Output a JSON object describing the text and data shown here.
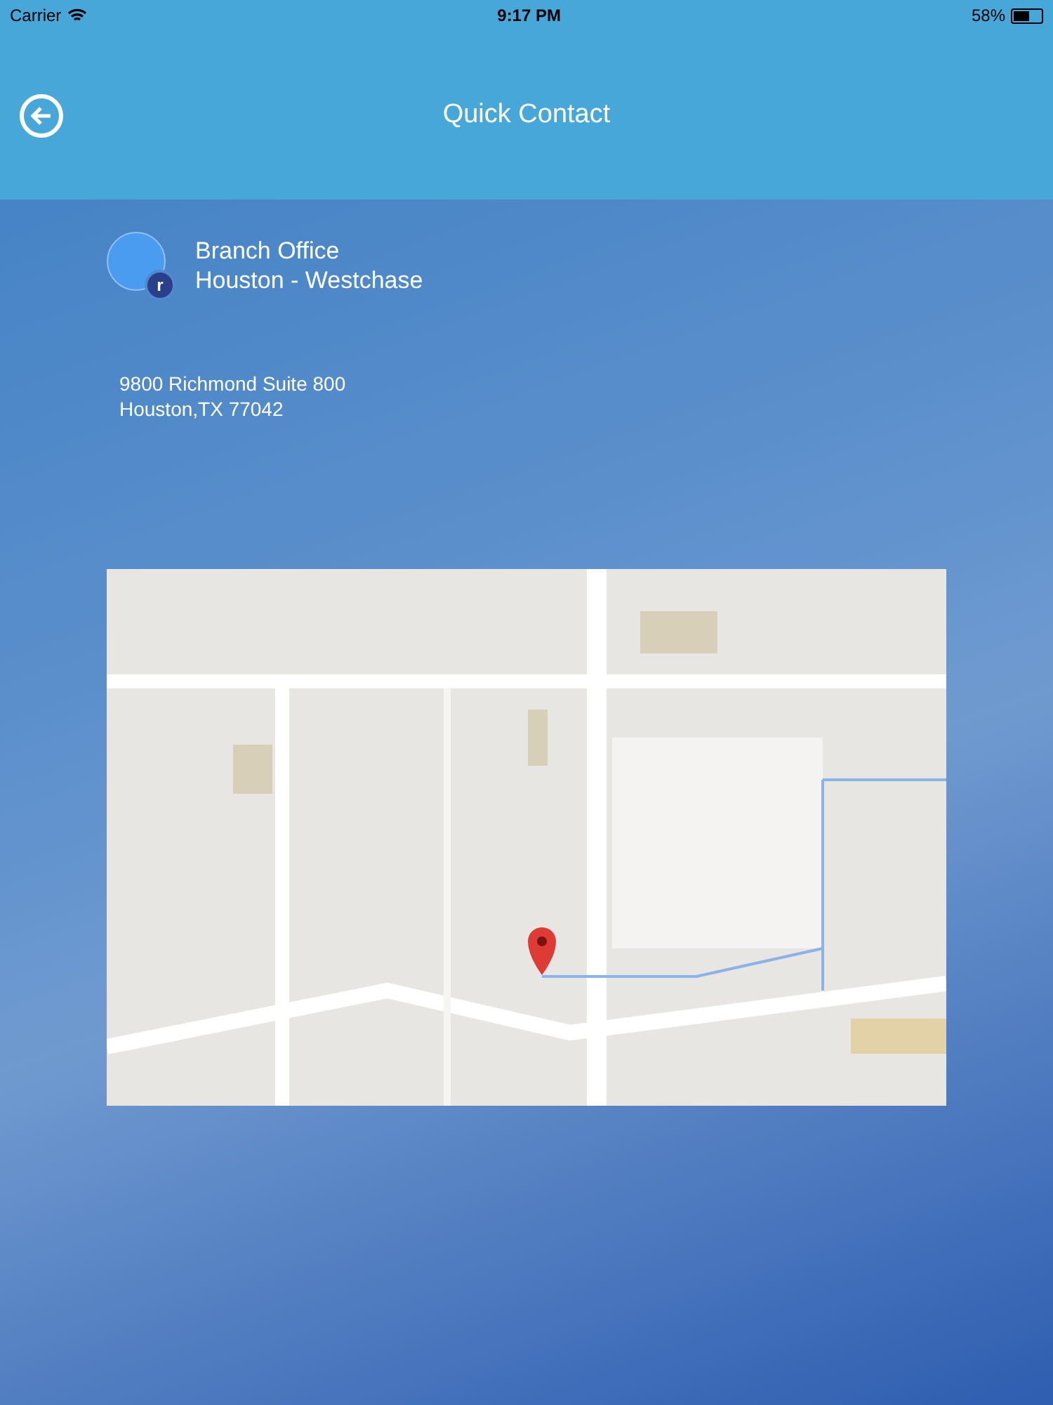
{
  "status_bar": {
    "carrier": "Carrier",
    "time": "9:17 PM",
    "battery": "58%"
  },
  "header": {
    "title": "Quick Contact"
  },
  "contact": {
    "badge": "r",
    "name": "Branch Office",
    "branch": "Houston - Westchase"
  },
  "address": [
    "9800 Richmond Suite 800",
    "Houston,TX 77042"
  ]
}
